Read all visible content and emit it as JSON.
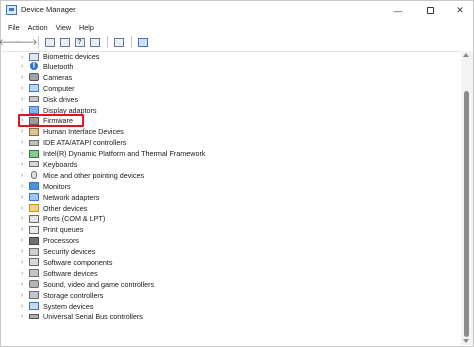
{
  "window": {
    "title": "Device Manager",
    "minimize_glyph": "—",
    "close_glyph": "✕"
  },
  "menu": {
    "items": [
      "File",
      "Action",
      "View",
      "Help"
    ]
  },
  "toolbar": {
    "back_glyph": "🡐",
    "forward_glyph": "🡒",
    "help_glyph": "?"
  },
  "tree": {
    "partial_top_item": "Biometric devices",
    "items": [
      {
        "label": "Bluetooth",
        "icon": "bluetooth-icon",
        "highlighted": true
      },
      {
        "label": "Cameras",
        "icon": "camera-icon"
      },
      {
        "label": "Computer",
        "icon": "computer-icon"
      },
      {
        "label": "Disk drives",
        "icon": "disk-drive-icon"
      },
      {
        "label": "Display adaptors",
        "icon": "display-adapter-icon"
      },
      {
        "label": "Firmware",
        "icon": "firmware-icon"
      },
      {
        "label": "Human Interface Devices",
        "icon": "hid-icon"
      },
      {
        "label": "IDE ATA/ATAPI controllers",
        "icon": "ide-controller-icon"
      },
      {
        "label": "Intel(R) Dynamic Platform and Thermal Framework",
        "icon": "intel-chip-icon"
      },
      {
        "label": "Keyboards",
        "icon": "keyboard-icon"
      },
      {
        "label": "Mice and other pointing devices",
        "icon": "mouse-icon"
      },
      {
        "label": "Monitors",
        "icon": "monitor-icon"
      },
      {
        "label": "Network adapters",
        "icon": "network-adapter-icon"
      },
      {
        "label": "Other devices",
        "icon": "other-devices-icon"
      },
      {
        "label": "Ports (COM & LPT)",
        "icon": "ports-icon"
      },
      {
        "label": "Print queues",
        "icon": "printer-icon"
      },
      {
        "label": "Processors",
        "icon": "processor-icon"
      },
      {
        "label": "Security devices",
        "icon": "security-device-icon"
      },
      {
        "label": "Software components",
        "icon": "software-component-icon"
      },
      {
        "label": "Software devices",
        "icon": "software-device-icon"
      },
      {
        "label": "Sound, video and game controllers",
        "icon": "sound-controller-icon"
      },
      {
        "label": "Storage controllers",
        "icon": "storage-controller-icon"
      },
      {
        "label": "System devices",
        "icon": "system-device-icon"
      },
      {
        "label": "Universal Serial Bus controllers",
        "icon": "usb-controller-icon"
      }
    ],
    "expand_glyph": "›"
  },
  "colors": {
    "highlight_border": "#e0141e",
    "accent": "#3b78c3"
  }
}
